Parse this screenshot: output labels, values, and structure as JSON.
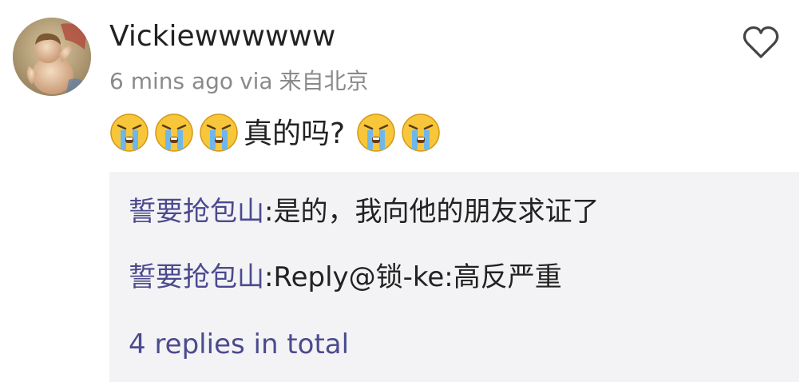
{
  "comment": {
    "username": "Vickiewwwwww",
    "time": "6 mins ago",
    "via": "via",
    "location": "来自北京",
    "text": "真的吗?",
    "emojis_before_text": 3,
    "emojis_after_text": 2,
    "emoji_icon": "crying-face-icon",
    "like_icon": "heart-outline-icon",
    "avatar_image": "cherub-painting"
  },
  "replies": {
    "items": [
      {
        "author": "誓要抢包山",
        "separator": ":",
        "text": "是的，我向他的朋友求证了"
      },
      {
        "author": "誓要抢包山",
        "separator": ":",
        "text": "Reply@锁-ke:高反严重"
      }
    ],
    "total_label": "4 replies in total"
  },
  "colors": {
    "username": "#222222",
    "meta": "#8a8a8a",
    "link": "#4c4a8e",
    "reply_background": "#f3f3f5"
  }
}
